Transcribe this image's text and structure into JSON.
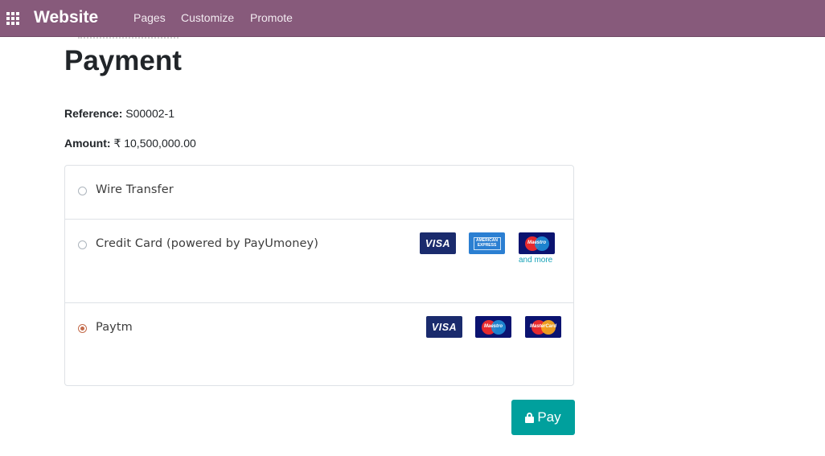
{
  "navbar": {
    "brand": "Website",
    "menu": [
      "Pages",
      "Customize",
      "Promote"
    ],
    "bg_color": "#875a7b",
    "apps_icon": "apps-grid-icon"
  },
  "page": {
    "title": "Payment",
    "reference_label": "Reference:",
    "reference_value": "S00002-1",
    "amount_label": "Amount:",
    "amount_value": "₹ 10,500,000.00"
  },
  "payment_methods": [
    {
      "label": "Wire Transfer",
      "selected": false,
      "icons": []
    },
    {
      "label": "Credit Card (powered by PayUmoney)",
      "selected": false,
      "icons": [
        "visa-icon",
        "american-express-icon",
        "maestro-icon"
      ],
      "icon_text": {
        "visa": "VISA",
        "amex": "AMERICAN EXPRESS",
        "maestro": "Maestro"
      },
      "more_link": "and more"
    },
    {
      "label": "Paytm",
      "selected": true,
      "icons": [
        "visa-icon",
        "maestro-icon",
        "mastercard-icon"
      ],
      "icon_text": {
        "visa": "VISA",
        "maestro": "Maestro",
        "mastercard": "MasterCard"
      }
    }
  ],
  "pay_button": {
    "label": "Pay",
    "icon": "lock-icon",
    "color": "#00a09d"
  },
  "accent_radio_color": "#c36b4b"
}
